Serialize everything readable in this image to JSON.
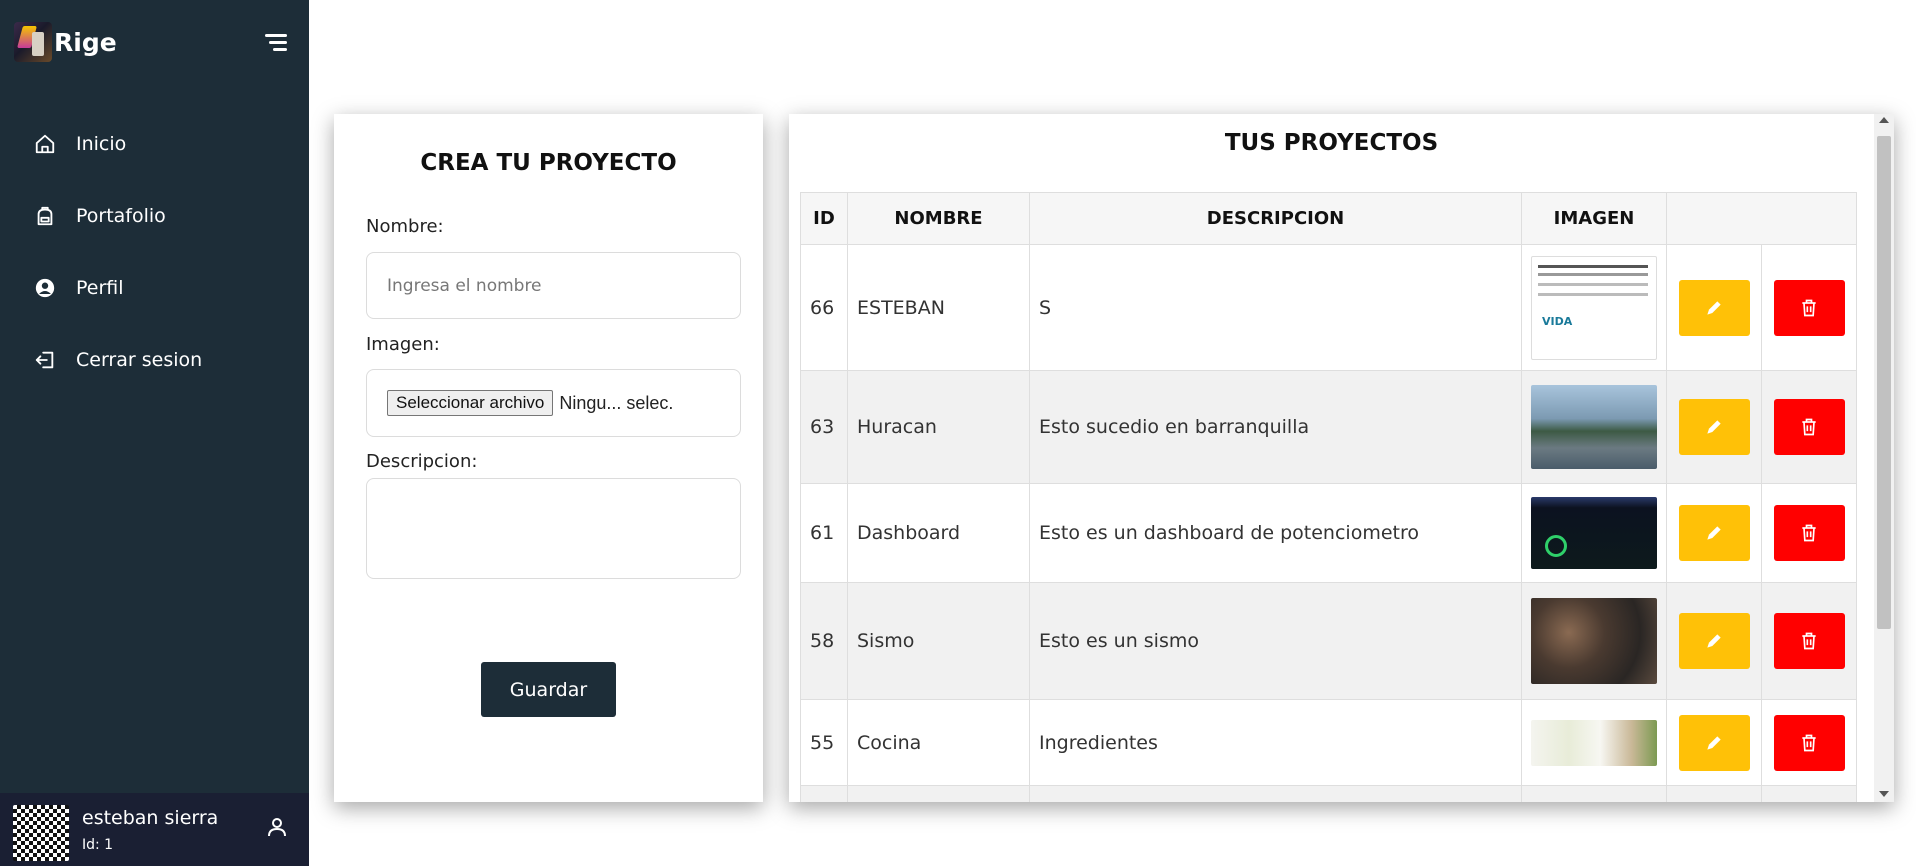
{
  "brand": {
    "name": "Rige"
  },
  "nav": [
    {
      "label": "Inicio",
      "icon": "home-icon"
    },
    {
      "label": "Portafolio",
      "icon": "backpack-icon"
    },
    {
      "label": "Perfil",
      "icon": "user-circle-icon"
    },
    {
      "label": "Cerrar sesion",
      "icon": "logout-icon"
    }
  ],
  "user": {
    "name": "esteban sierra",
    "id_label": "Id: 1"
  },
  "form": {
    "title": "CREA TU PROYECTO",
    "name_label": "Nombre:",
    "name_placeholder": "Ingresa el nombre",
    "image_label": "Imagen:",
    "file_button": "Seleccionar archivo",
    "file_status": "Ningu... selec.",
    "description_label": "Descripcion:",
    "save_button": "Guardar"
  },
  "projects": {
    "title": "TUS PROYECTOS",
    "columns": [
      "ID",
      "NOMBRE",
      "DESCRIPCION",
      "IMAGEN"
    ],
    "rows": [
      {
        "id": "66",
        "name": "ESTEBAN",
        "description": "S"
      },
      {
        "id": "63",
        "name": "Huracan",
        "description": "Esto sucedio en barranquilla"
      },
      {
        "id": "61",
        "name": "Dashboard",
        "description": "Esto es un dashboard de potenciometro"
      },
      {
        "id": "58",
        "name": "Sismo",
        "description": "Esto es un sismo"
      },
      {
        "id": "55",
        "name": "Cocina",
        "description": "Ingredientes"
      },
      {
        "id": "",
        "name": "",
        "description": ""
      }
    ]
  },
  "colors": {
    "sidebar": "#1d2d38",
    "edit_button": "#ffc107",
    "delete_button": "#ff0000"
  }
}
